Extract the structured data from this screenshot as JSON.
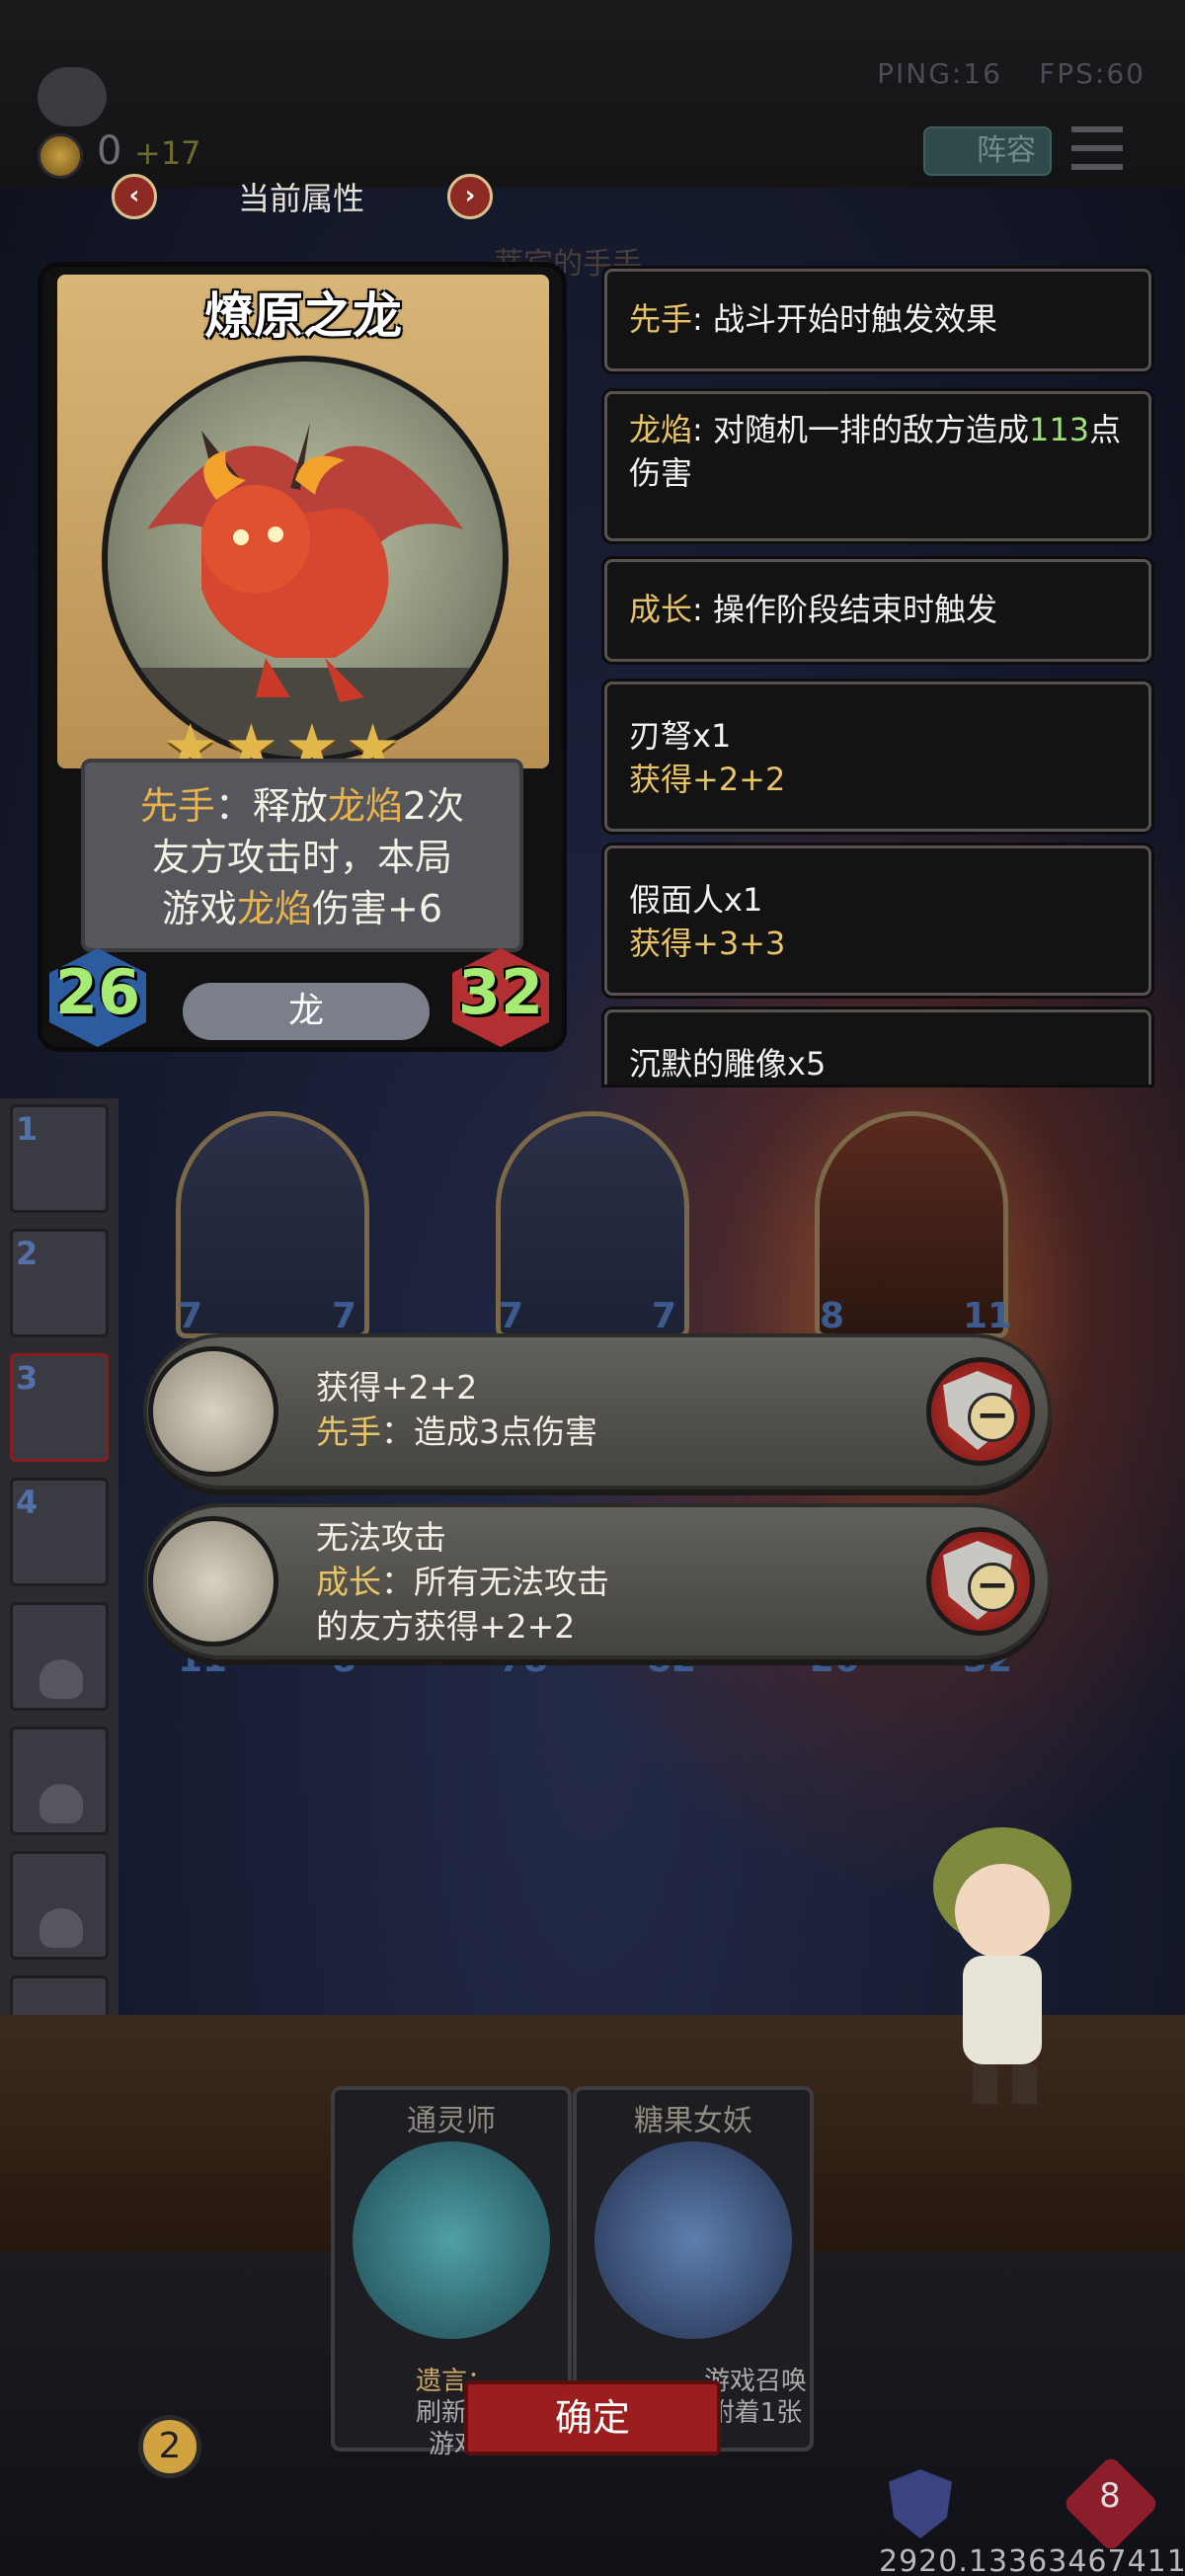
{
  "status": {
    "ping": "PING:16",
    "fps": "FPS:60"
  },
  "currency": {
    "coins": "0",
    "bonus": "+17"
  },
  "header": {
    "lineup_label": "阵容",
    "attr_title": "当前属性",
    "faint_title": "蒂宾的手手",
    "prev": "‹",
    "next": "›"
  },
  "card": {
    "name": "燎原之龙",
    "stars": "★★★★",
    "desc": [
      {
        "pre": "",
        "kw": "先手",
        "post": "：释放"
      },
      {
        "pre": "友方攻击时，本局",
        "kw": "",
        "post": ""
      },
      {
        "pre": "游戏",
        "kw": "龙焰",
        "post": "伤害+6"
      }
    ],
    "desc_line1_kw2": "龙焰",
    "desc_line1_tail": "2次",
    "attack": "26",
    "health": "32",
    "tribe": "龙"
  },
  "info_panels": [
    {
      "kw": "先手",
      "text": ": 战斗开始时触发效果"
    },
    {
      "kw": "龙焰",
      "text_a": ": 对随机一排的敌方造成",
      "num": "113",
      "text_b": "点伤害"
    },
    {
      "kw": "成长",
      "text": ": 操作阶段结束时触发"
    },
    {
      "title": "刃弩x1",
      "gain": "获得+2+2"
    },
    {
      "title": "假面人x1",
      "gain": "获得+3+3"
    },
    {
      "title": "沉默的雕像x5"
    }
  ],
  "board": {
    "top_nums": [
      "7",
      "7",
      "7",
      "7",
      "8",
      "11"
    ],
    "bottom_nums": [
      "11",
      "8",
      "78",
      "82",
      "26",
      "32"
    ]
  },
  "roster": {
    "nums": [
      "1",
      "2",
      "3",
      "4"
    ]
  },
  "popups": [
    {
      "line1": "获得+2+2",
      "kw": "先手",
      "line2": "：造成3点伤害"
    },
    {
      "line1": "无法攻击",
      "kw": "成长",
      "line2": "：所有无法攻击",
      "line3": "的友方获得+2+2"
    }
  ],
  "hand": [
    {
      "name": "通灵师",
      "text1": "遗言：",
      "text2": "刷新商",
      "text3": "游戏"
    },
    {
      "name": "糖果女妖",
      "text1": "游戏召唤",
      "text2": "附着1张",
      "text3": ""
    }
  ],
  "confirm_label": "确定",
  "level": "2",
  "player_hp": "8",
  "seed": "2920.13363467411"
}
